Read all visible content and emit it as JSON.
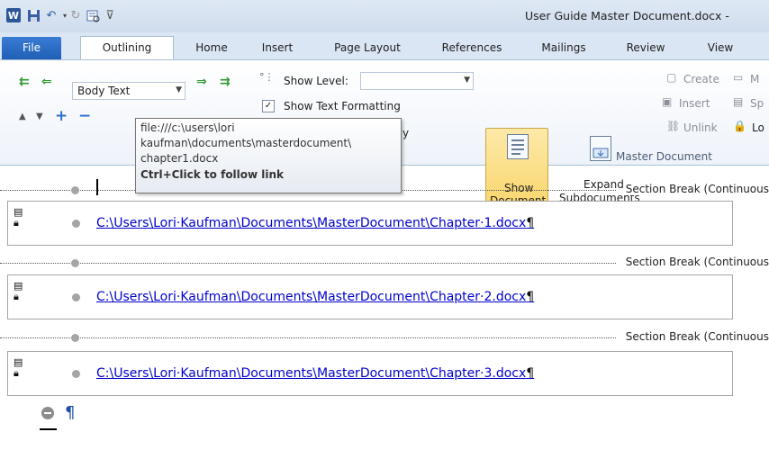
{
  "window": {
    "title": "User Guide Master Document.docx -"
  },
  "tabs": [
    {
      "label": "File"
    },
    {
      "label": "Outlining"
    },
    {
      "label": "Home"
    },
    {
      "label": "Insert"
    },
    {
      "label": "Page Layout"
    },
    {
      "label": "References"
    },
    {
      "label": "Mailings"
    },
    {
      "label": "Review"
    },
    {
      "label": "View"
    }
  ],
  "outline_tools": {
    "level_value": "Body Text",
    "show_level_label": "Show Level:",
    "show_level_value": "",
    "show_text_formatting_label": "Show Text Formatting",
    "show_text_formatting_checked": true,
    "show_first_line_partial": "y"
  },
  "master_document": {
    "show_document_line1": "Show",
    "show_document_line2": "Document",
    "expand_line1": "Expand",
    "expand_line2": "Subdocuments",
    "create_label": "Create",
    "merge_partial": "M",
    "insert_label": "Insert",
    "split_partial": "Sp",
    "unlink_label": "Unlink",
    "lock_partial": "Lo",
    "group_label": "Master Document"
  },
  "tooltip": {
    "line1": "file:///c:\\users\\lori",
    "line2": "kaufman\\documents\\masterdocument\\",
    "line3": "chapter1.docx",
    "line4": "Ctrl+Click to follow link"
  },
  "document": {
    "section_break_label": "Section Break (Continuous",
    "subdocuments": [
      {
        "path": "C:\\Users\\Lori·Kaufman\\Documents\\MasterDocument\\Chapter·1.docx"
      },
      {
        "path": "C:\\Users\\Lori·Kaufman\\Documents\\MasterDocument\\Chapter·2.docx"
      },
      {
        "path": "C:\\Users\\Lori·Kaufman\\Documents\\MasterDocument\\Chapter·3.docx"
      }
    ],
    "pilcrow": "¶"
  },
  "colors": {
    "file_tab": "#2a6cc7",
    "show_document_active": "#f9d365",
    "hyperlink": "#0000cc",
    "arrow_green": "#2f9a2f"
  }
}
